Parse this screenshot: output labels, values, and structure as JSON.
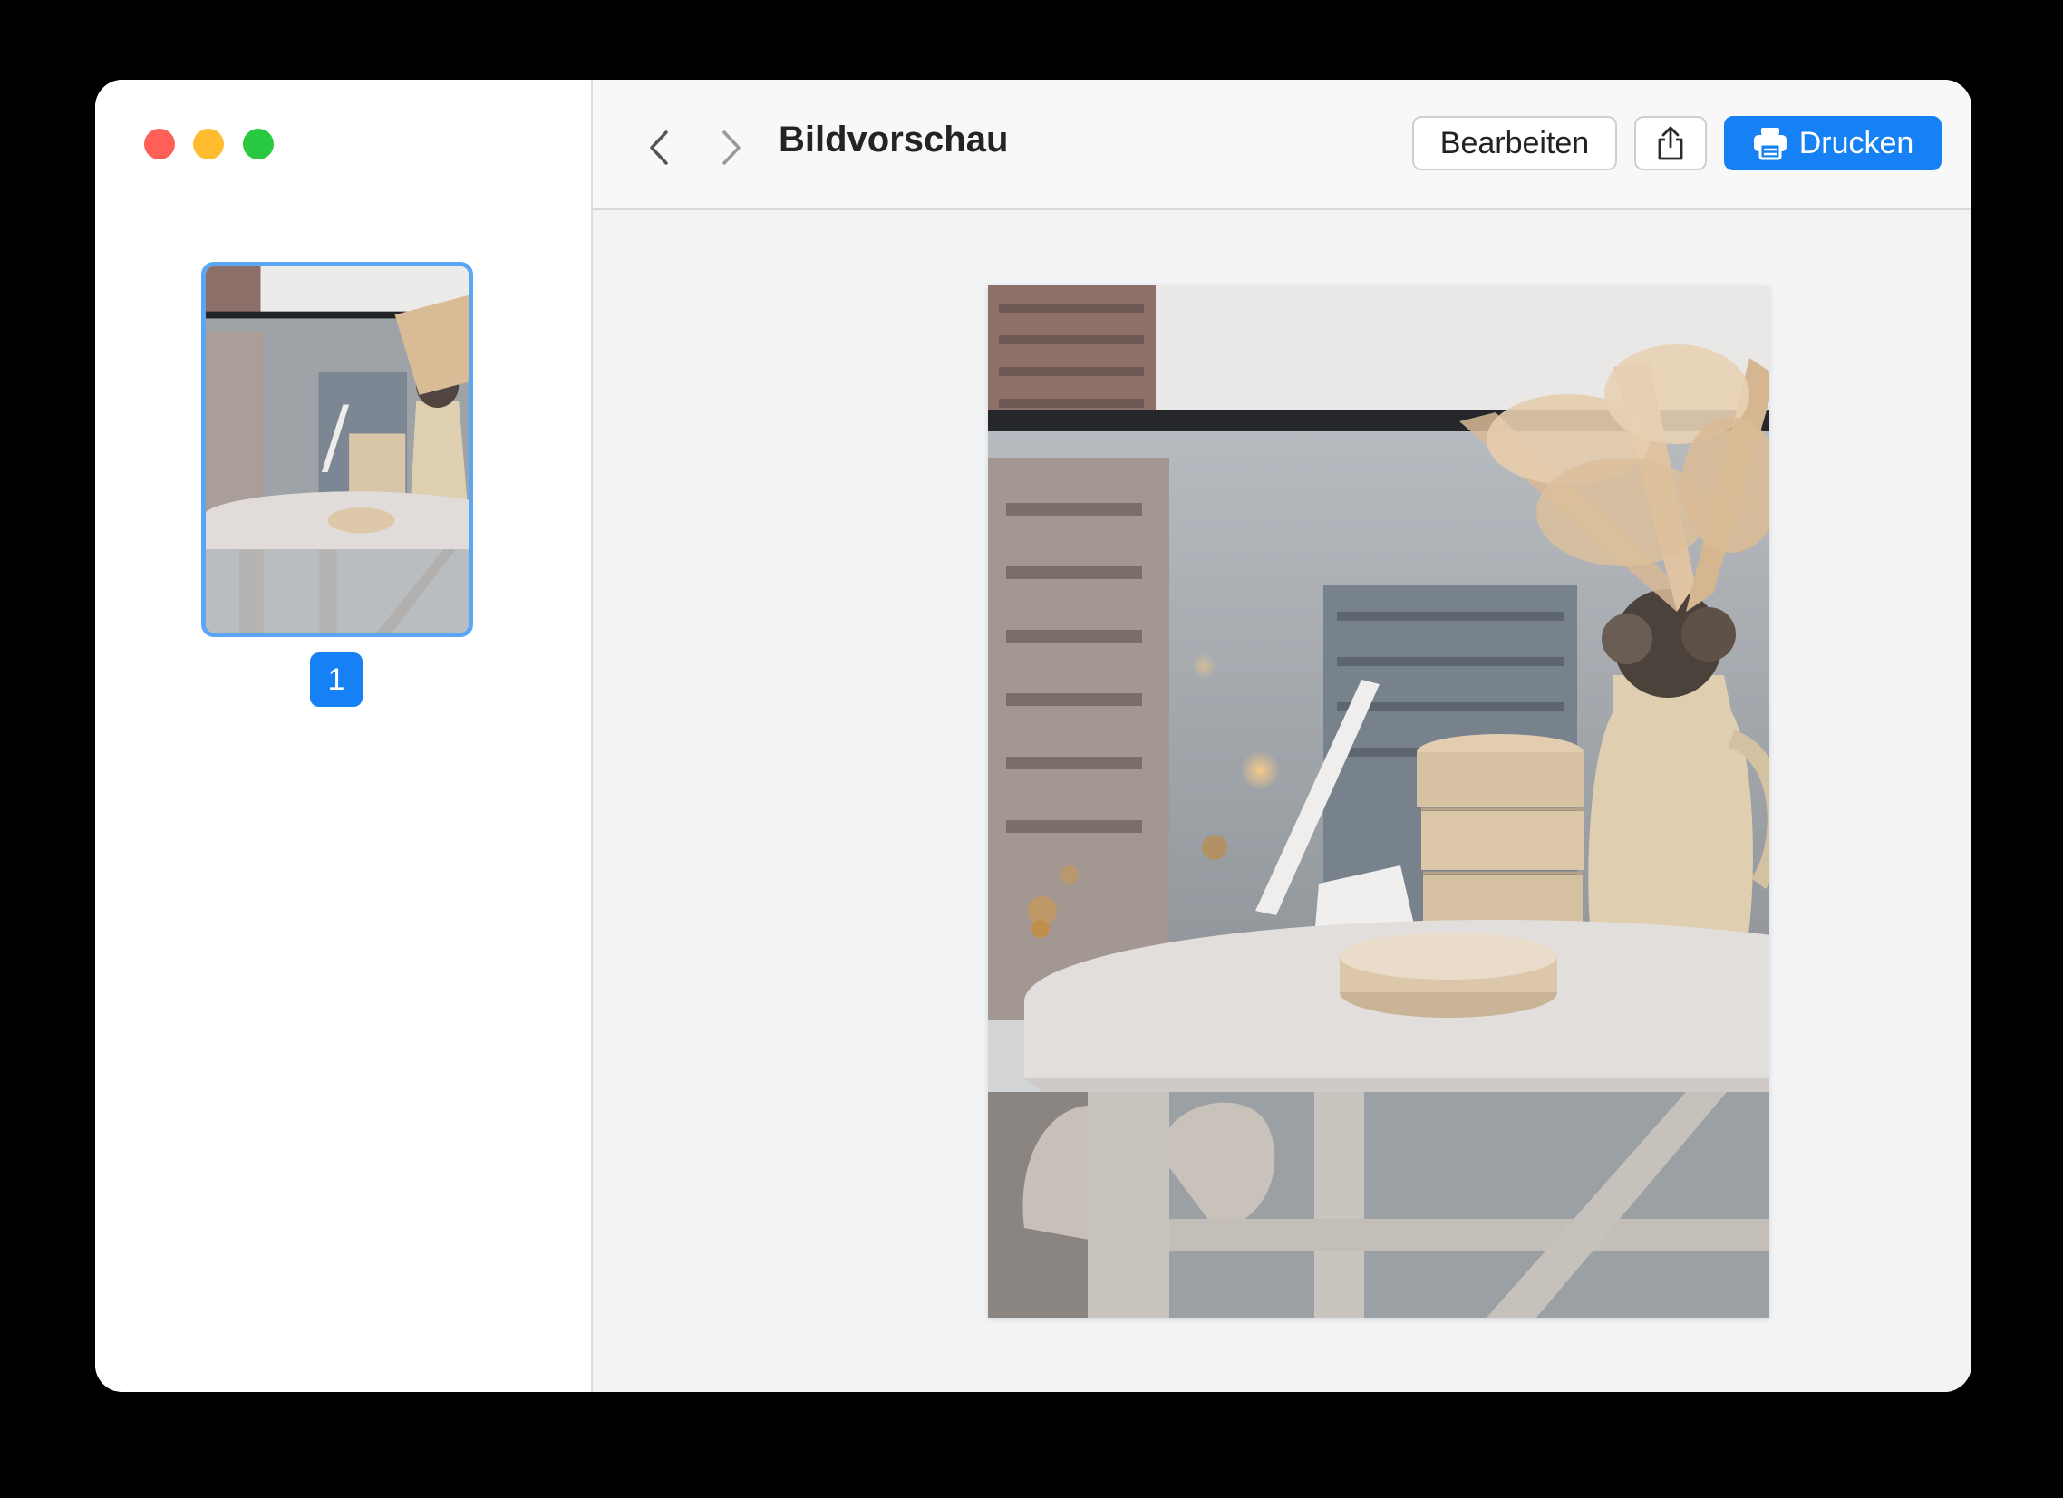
{
  "window": {
    "title": "Bildvorschau",
    "traffic_lights": {
      "close_color": "#fe5f57",
      "minimize_color": "#febc2e",
      "zoom_color": "#28c840"
    }
  },
  "sidebar": {
    "thumbnails": [
      {
        "page_number": "1",
        "selected": true
      }
    ]
  },
  "toolbar": {
    "back_icon": "chevron-left-icon",
    "forward_icon": "chevron-right-icon",
    "edit_label": "Bearbeiten",
    "share_icon": "share-icon",
    "print_label": "Drucken",
    "print_icon": "printer-icon"
  },
  "colors": {
    "accent": "#1581f4",
    "selection_border": "#5aa6f5",
    "content_background": "#f2f3f5"
  },
  "preview": {
    "image_subject": "Runder Tisch mit Vase, Trockenblumen und Keramikbechern vor regennasser Fensterscheibe"
  }
}
